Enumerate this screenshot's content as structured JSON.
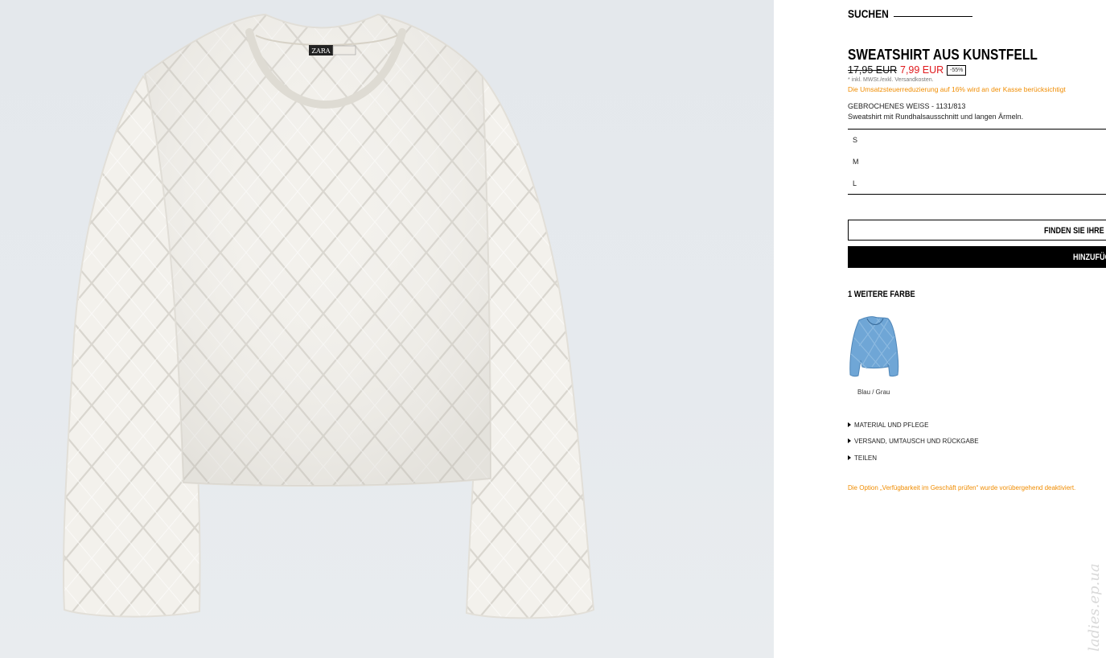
{
  "header": {
    "search_label": "SUCHEN"
  },
  "product": {
    "image_label": "ZARA",
    "title": "SWEATSHIRT AUS KUNSTFELL",
    "price_old": "17,95 EUR",
    "price_new": "7,99 EUR",
    "discount": "-55%",
    "tax_note": "* inkl. MWSt./exkl. Versandkosten.",
    "vat_note": "Die Umsatzsteuerreduzierung auf 16% wird an der Kasse berücksichtigt",
    "color_ref": "GEBROCHENES WEISS - 1131/813",
    "description": "Sweatshirt mit Rundhalsausschnitt und langen Ärmeln."
  },
  "sizes": [
    "S",
    "M",
    "L"
  ],
  "buttons": {
    "find_size": "FINDEN SIE IHRE GRÖSSE",
    "add": "HINZUFÜGEN"
  },
  "more_colors": {
    "heading": "1 WEITERE FARBE",
    "item_label": "Blau / Grau",
    "item_color": "#6fa6d6"
  },
  "accordion": [
    "MATERIAL UND PFLEGE",
    "VERSAND, UMTAUSCH UND RÜCKGABE",
    "TEILEN"
  ],
  "availability_note": "Die Option „Verfügbarkeit im Geschäft prüfen“ wurde vorübergehend deaktiviert.",
  "watermark": "ladies.ep.ua",
  "colors": {
    "accent_red": "#e0181c",
    "note_orange": "#f08c00",
    "photo_bg": "#e6eaee",
    "sweater": "#f4f2ee"
  }
}
